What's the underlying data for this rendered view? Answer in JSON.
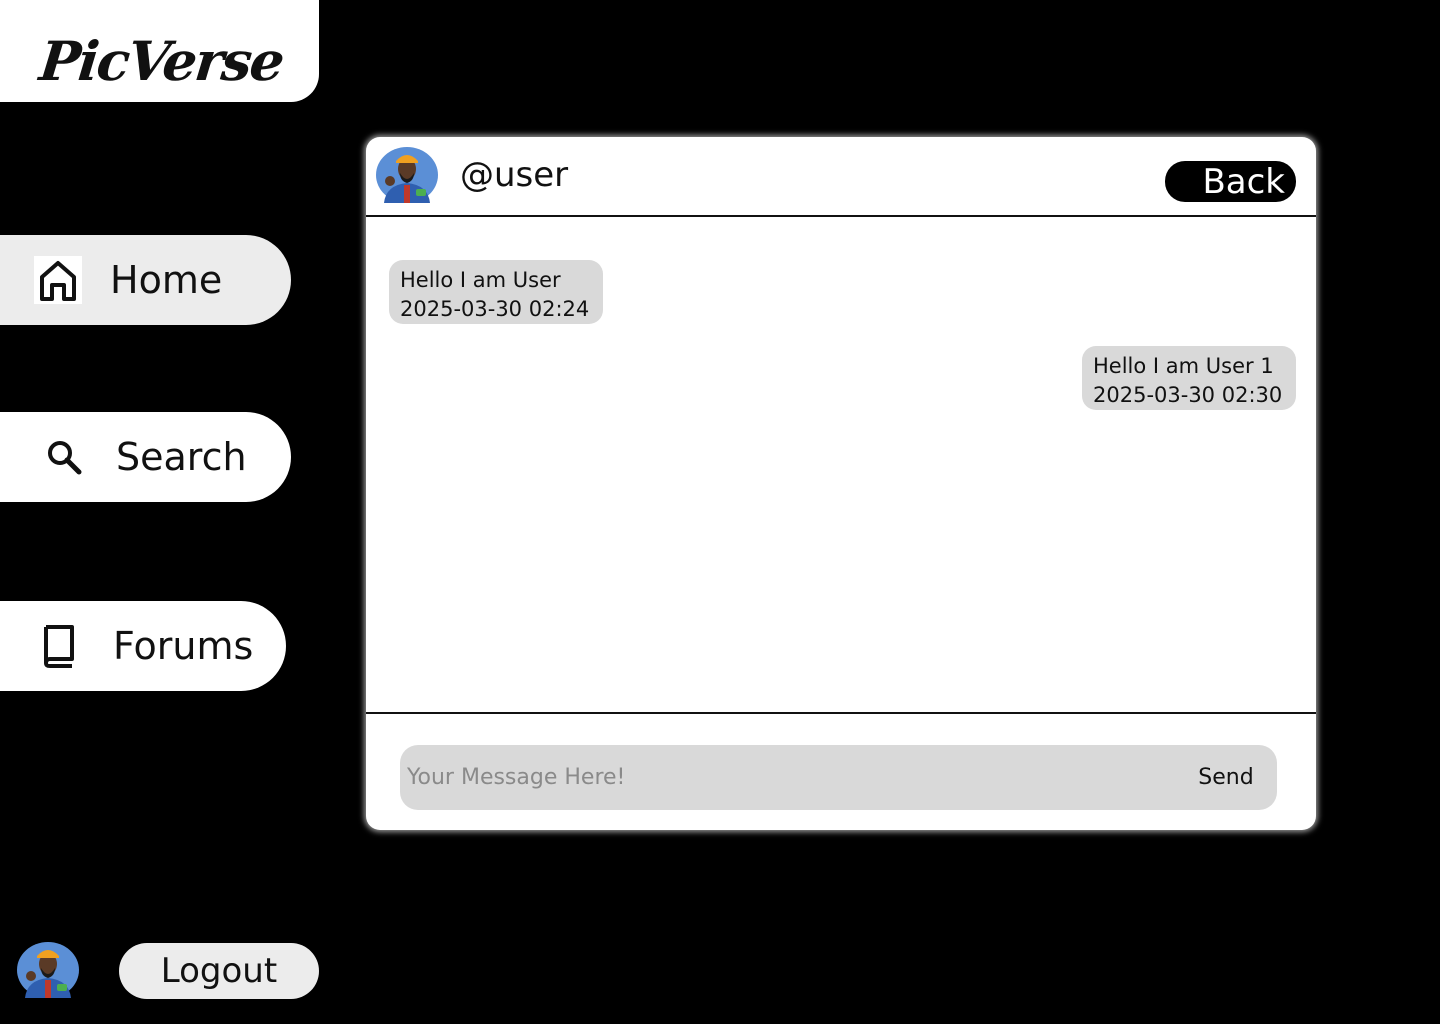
{
  "logo": {
    "text": "PicVerse"
  },
  "sidebar": {
    "items": [
      {
        "label": "Home",
        "icon": "home-icon"
      },
      {
        "label": "Search",
        "icon": "search-icon"
      },
      {
        "label": "Forums",
        "icon": "book-icon"
      }
    ]
  },
  "account": {
    "logout_label": "Logout",
    "avatar": "avatar-icon"
  },
  "chat": {
    "username": "@user",
    "back_label": "Back",
    "messages": [
      {
        "side": "left",
        "text": "Hello I am User",
        "time": "2025-03-30 02:24"
      },
      {
        "side": "right",
        "text": "Hello I am User 1",
        "time": "2025-03-30 02:30"
      }
    ],
    "input_placeholder": "Your Message Here!",
    "input_value": "",
    "send_label": "Send"
  },
  "colors": {
    "background": "#000000",
    "panel": "#ffffff",
    "pill": "#ececec",
    "bubble": "#d9d9d9"
  }
}
